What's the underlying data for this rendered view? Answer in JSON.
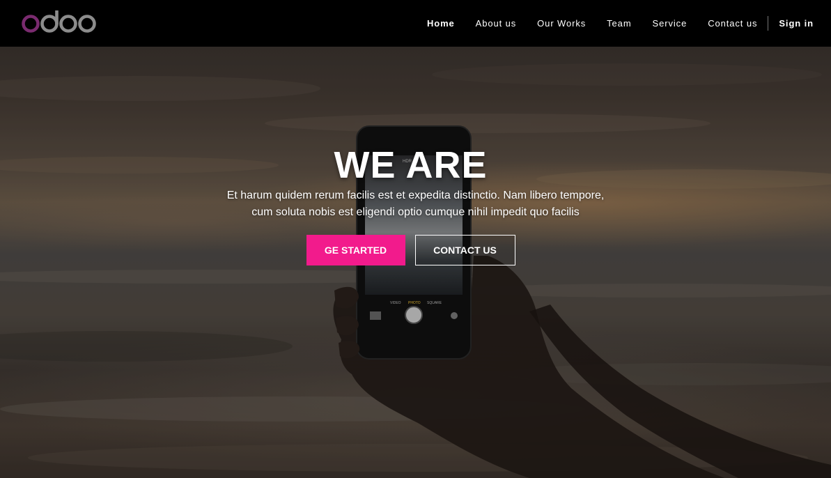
{
  "brand": {
    "logo_text": "odoo",
    "logo_accent": "#7a2b6f",
    "logo_gray": "#8c8c8c"
  },
  "nav": {
    "items": [
      {
        "label": "Home",
        "active": true
      },
      {
        "label": "About us"
      },
      {
        "label": "Our Works"
      },
      {
        "label": "Team"
      },
      {
        "label": "Service"
      },
      {
        "label": "Contact us"
      }
    ],
    "signin_label": "Sign in"
  },
  "hero": {
    "title": "WE ARE",
    "subtitle_line1": "Et harum quidem rerum facilis est et expedita distinctio. Nam libero tempore,",
    "subtitle_line2": "cum soluta nobis est eligendi optio cumque nihil impedit quo facilis",
    "primary_button": "GE STARTED",
    "secondary_button": "CONTACT US",
    "accent_color": "#f21b8c",
    "phone_screen_text": {
      "top_label": "HDR Off",
      "modes": [
        "VIDEO",
        "PHOTO",
        "SQUARE"
      ]
    }
  }
}
